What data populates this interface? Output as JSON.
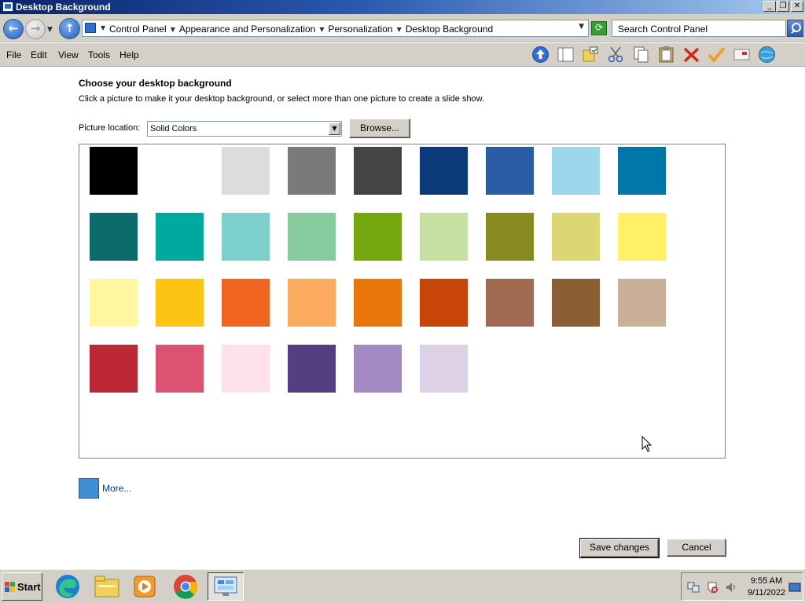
{
  "window": {
    "title": "Desktop Background"
  },
  "address_bar": {
    "crumbs": [
      "Control Panel",
      "Appearance and Personalization",
      "Personalization",
      "Desktop Background"
    ],
    "search_placeholder": "Search Control Panel"
  },
  "menu": {
    "items": [
      "File",
      "Edit",
      "View",
      "Tools",
      "Help"
    ]
  },
  "toolbar_icons": [
    "up-icon",
    "folders-icon",
    "folder-options-icon",
    "cut-icon",
    "copy-icon",
    "paste-icon",
    "delete-icon",
    "properties-check-icon",
    "mail-icon",
    "globe-icon"
  ],
  "content": {
    "title": "Choose your desktop background",
    "description": "Click a picture to make it your desktop background, or select more than one picture to create a slide show.",
    "location_label": "Picture location:",
    "location_value": "Solid Colors",
    "browse_label": "Browse...",
    "more_label": "More...",
    "more_color": "#3f8ed4",
    "save_label": "Save changes",
    "cancel_label": "Cancel"
  },
  "swatches": [
    [
      "#000000",
      "#ffffff",
      "#dcdcdc",
      "#7a7a7a",
      "#444444",
      "#0b3a7a",
      "#2a5da6",
      "#9cd7ec",
      "#0077a8"
    ],
    [
      "#0d6b6b",
      "#00a99d",
      "#7dcfcb",
      "#86cb9d",
      "#74a80e",
      "#c5e0a0",
      "#868a1f",
      "#dbd873",
      "#fff066"
    ],
    [
      "#fff6a0",
      "#fec414",
      "#ee6420",
      "#fdab5e",
      "#e9760a",
      "#c84508",
      "#a06a50",
      "#8b5e34",
      "#c9b096"
    ],
    [
      "#bd2837",
      "#dc5272",
      "#fde0ea",
      "#553e82",
      "#a388c1",
      "#dcd1e6"
    ]
  ],
  "taskbar": {
    "start_label": "Start",
    "apps": [
      "edge-icon",
      "file-explorer-icon",
      "media-player-icon",
      "chrome-icon",
      "control-panel-icon"
    ],
    "tray_icons": [
      "network-icon",
      "security-alert-icon",
      "volume-icon"
    ],
    "time": "9:55 AM",
    "date": "9/11/2022"
  }
}
